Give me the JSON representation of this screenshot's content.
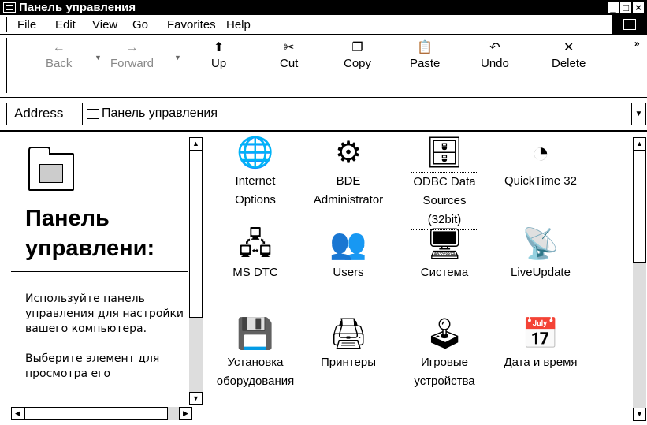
{
  "window": {
    "title": "Панель управления"
  },
  "menu": [
    {
      "label": "File",
      "key": "F"
    },
    {
      "label": "Edit",
      "key": "E"
    },
    {
      "label": "View",
      "key": "V"
    },
    {
      "label": "Go",
      "key": "G"
    },
    {
      "label": "Favorites",
      "key": "a"
    },
    {
      "label": "Help",
      "key": "H"
    }
  ],
  "toolbar": {
    "back": "Back",
    "forward": "Forward",
    "up": "Up",
    "cut": "Cut",
    "copy": "Copy",
    "paste": "Paste",
    "undo": "Undo",
    "delete": "Delete"
  },
  "address": {
    "label": "Address",
    "value": "Панель управления"
  },
  "leftpane": {
    "title_line1": "Панель",
    "title_line2": "управлени:",
    "desc1": "Используйте панель управления для настройки вашего компьютера.",
    "desc2": "Выберите элемент для просмотра его"
  },
  "items": [
    {
      "label": "Internet\nOptions",
      "icon": "globe-tools-icon",
      "selected": false
    },
    {
      "label": "BDE\nAdministrator",
      "icon": "bde-gear-icon",
      "selected": false
    },
    {
      "label": "ODBC Data\nSources\n(32bit)",
      "icon": "odbc-database-icon",
      "selected": true
    },
    {
      "label": "QuickTime 32",
      "icon": "quicktime-icon",
      "selected": false
    },
    {
      "label": "MS DTC",
      "icon": "network-nodes-icon",
      "selected": false
    },
    {
      "label": "Users",
      "icon": "users-icon",
      "selected": false
    },
    {
      "label": "Система",
      "icon": "computer-icon",
      "selected": false
    },
    {
      "label": "LiveUpdate",
      "icon": "liveupdate-icon",
      "selected": false
    },
    {
      "label": "Установка\nоборудования",
      "icon": "hardware-icon",
      "selected": false
    },
    {
      "label": "Принтеры",
      "icon": "printer-icon",
      "selected": false
    },
    {
      "label": "Игровые\nустройства",
      "icon": "joystick-icon",
      "selected": false
    },
    {
      "label": "Дата и время",
      "icon": "calendar-clock-icon",
      "selected": false
    }
  ]
}
